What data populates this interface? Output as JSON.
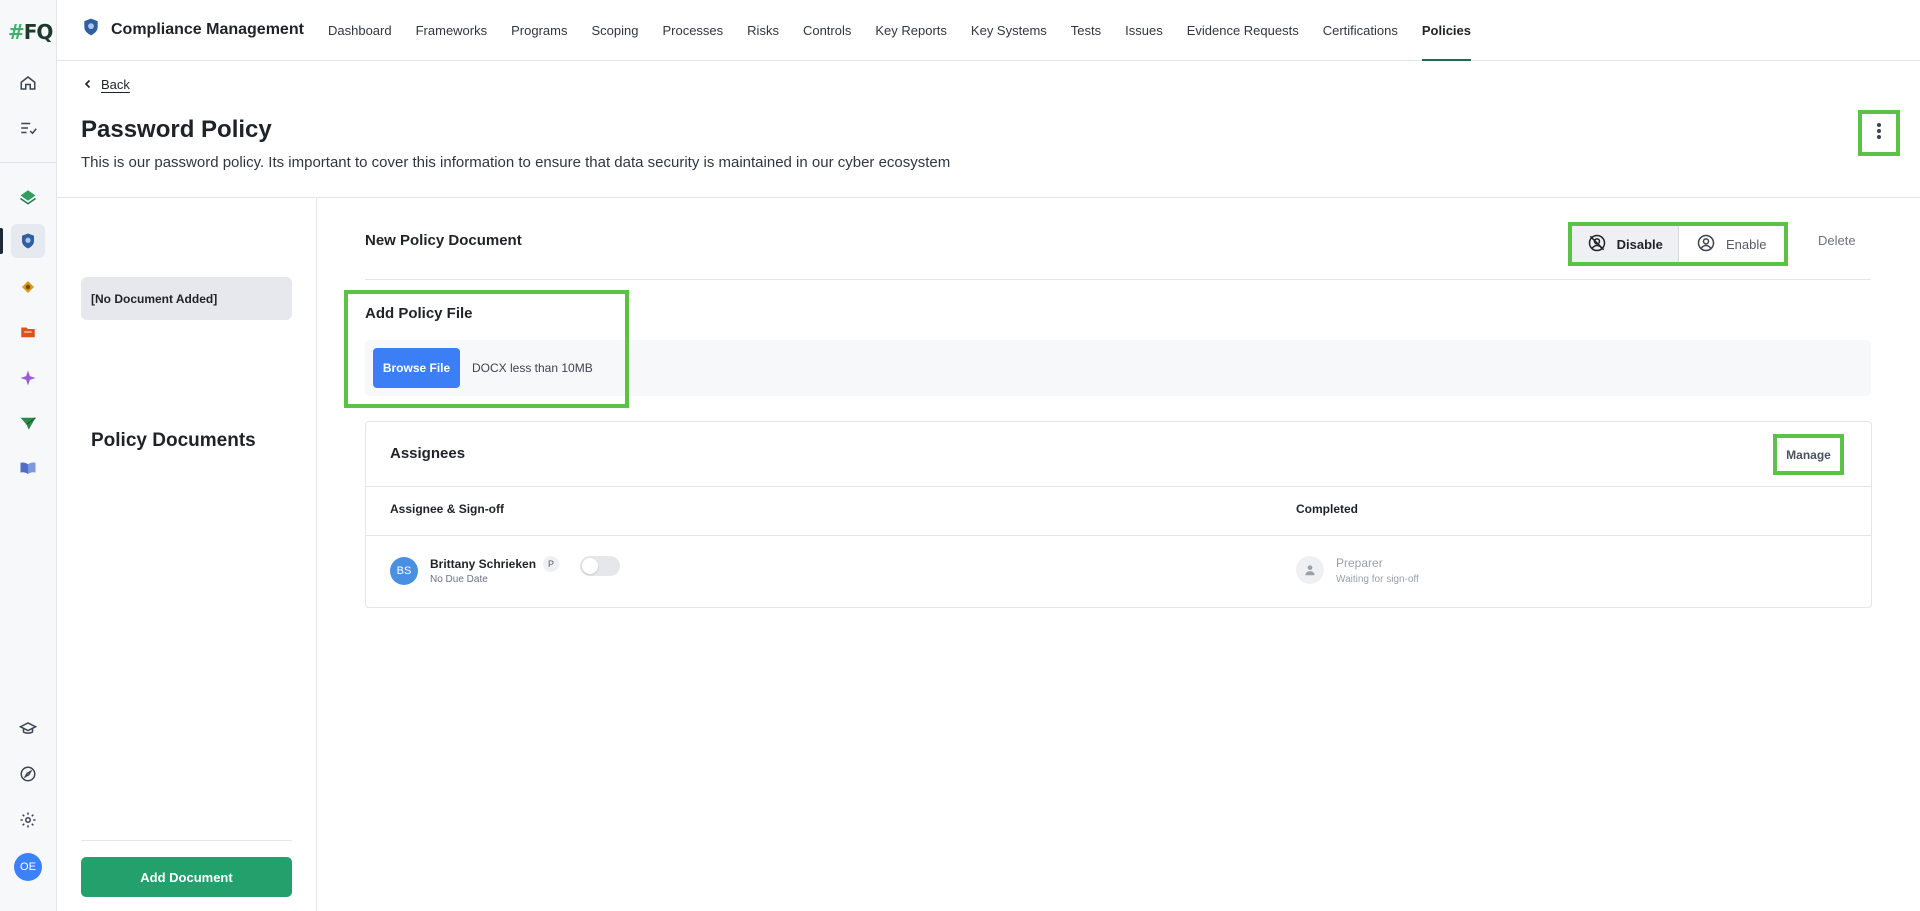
{
  "rail": {
    "logo_hash": "#",
    "logo_text": "FQ",
    "items": [
      {
        "name": "home-icon"
      },
      {
        "name": "tasks-icon"
      },
      {
        "name": "layers-icon"
      },
      {
        "name": "compliance-shield-icon"
      },
      {
        "name": "risk-icon"
      },
      {
        "name": "folder-icon"
      },
      {
        "name": "sparkle-icon"
      },
      {
        "name": "send-icon"
      },
      {
        "name": "book-icon"
      },
      {
        "name": "academy-icon"
      },
      {
        "name": "compass-icon"
      },
      {
        "name": "settings-icon"
      }
    ],
    "avatar_initials": "OE"
  },
  "topbar": {
    "app_title": "Compliance Management",
    "tabs": [
      "Dashboard",
      "Frameworks",
      "Programs",
      "Scoping",
      "Processes",
      "Risks",
      "Controls",
      "Key Reports",
      "Key Systems",
      "Tests",
      "Issues",
      "Evidence Requests",
      "Certifications",
      "Policies"
    ],
    "active_tab": "Policies"
  },
  "header": {
    "back_label": "Back",
    "title": "Password Policy",
    "description": "This is our password policy. Its important to cover this information to ensure that data security is maintained in our cyber ecosystem"
  },
  "docs_panel": {
    "title": "Policy Documents",
    "items": [
      "[No Document Added]"
    ],
    "add_button": "Add Document"
  },
  "document": {
    "heading": "New Policy Document",
    "disable_label": "Disable",
    "enable_label": "Enable",
    "delete_label": "Delete",
    "add_file_title": "Add Policy File",
    "browse_label": "Browse File",
    "file_hint": "DOCX less than 10MB"
  },
  "assignees": {
    "title": "Assignees",
    "manage_label": "Manage",
    "columns": [
      "Assignee & Sign-off",
      "Completed"
    ],
    "rows": [
      {
        "initials": "BS",
        "name": "Brittany Schrieken",
        "badge": "P",
        "due": "No Due Date",
        "signed_off": false,
        "role": "Preparer",
        "status": "Waiting for sign-off"
      }
    ]
  },
  "colors": {
    "accent_green": "#23a06b",
    "highlight_green": "#5ac245",
    "primary_blue": "#3b7ef6"
  }
}
